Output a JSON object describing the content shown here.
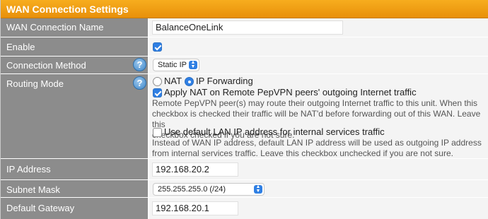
{
  "section_title": "WAN Connection Settings",
  "wan_name": {
    "label": "WAN Connection Name",
    "value": "BalanceOneLink"
  },
  "enable": {
    "label": "Enable",
    "checked": true
  },
  "connection_method": {
    "label": "Connection Method",
    "selected": "Static IP"
  },
  "routing_mode": {
    "label": "Routing Mode",
    "nat_label": "NAT",
    "ip_forwarding_label": "IP Forwarding",
    "selected": "IP Forwarding",
    "apply_nat_label": "Apply NAT on Remote PepVPN peers' outgoing Internet traffic",
    "apply_nat_desc_1": "Remote PepVPN peer(s) may route their outgoing Internet traffic to this unit. When this",
    "apply_nat_desc_2": "checkbox is checked their traffic will be NAT'd before forwarding out of this WAN. Leave this",
    "apply_nat_desc_3": "checkbox checked if you are not sure.",
    "default_lan_label": "Use default LAN IP address for internal services traffic",
    "default_lan_desc_1": "Instead of WAN IP address, default LAN IP address will be used as outgoing IP address",
    "default_lan_desc_2": "from internal services traffic. Leave this checkbox unchecked if you are not sure."
  },
  "ip_address": {
    "label": "IP Address",
    "value": "192.168.20.2"
  },
  "subnet_mask": {
    "label": "Subnet Mask",
    "selected": "255.255.255.0 (/24)"
  },
  "default_gateway": {
    "label": "Default Gateway",
    "value": "192.168.20.1"
  },
  "help_glyph": "?",
  "colors": {
    "header": "#f0a01a",
    "label_bg": "#8c8c8c",
    "value_bg": "#f4f4f4",
    "accent": "#2f7fe3"
  },
  "icons": [
    "help-icon",
    "checkbox-checked",
    "checkbox-unchecked",
    "radio",
    "select-arrows"
  ]
}
